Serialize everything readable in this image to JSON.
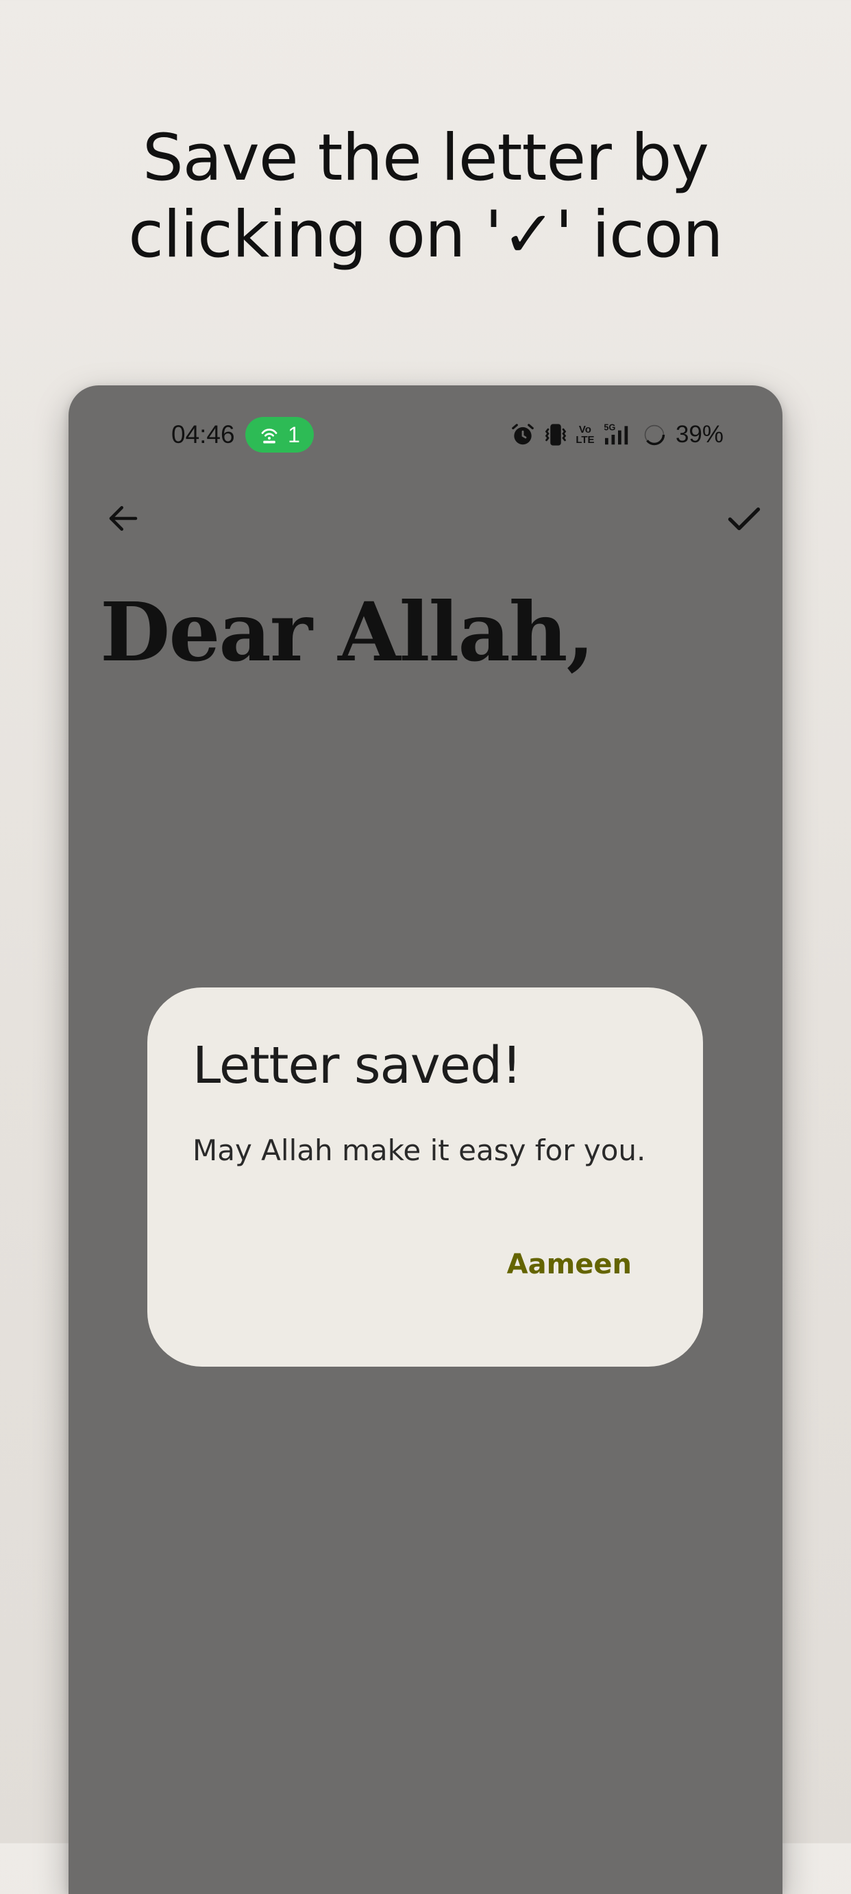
{
  "promo": {
    "headline_line1": "Save the letter by",
    "headline_line2": "clicking on '✓' icon"
  },
  "status_bar": {
    "time": "04:46",
    "hotspot_count": "1",
    "volte_top": "Vo",
    "volte_bottom": "LTE",
    "network": "5G",
    "battery": "39%",
    "hotspot_color": "#2dbb55"
  },
  "toolbar": {
    "back_icon": "arrow-left-icon",
    "save_icon": "check-icon"
  },
  "letter": {
    "heading": "Dear Allah,"
  },
  "dialog": {
    "title": "Letter saved!",
    "message": "May Allah make it easy for you.",
    "action_label": "Aameen",
    "action_color": "#646400"
  }
}
